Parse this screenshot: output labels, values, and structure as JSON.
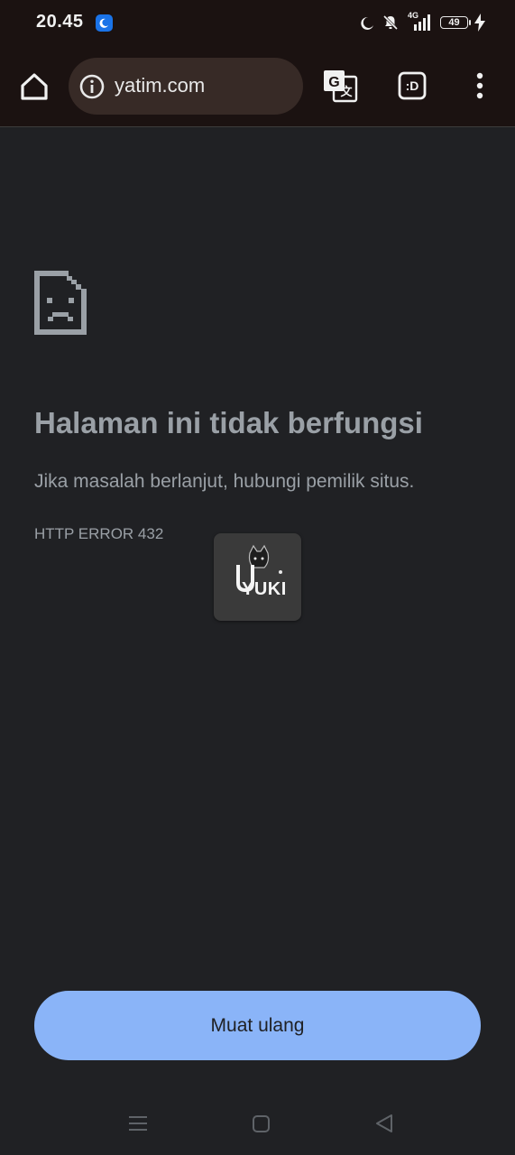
{
  "status_bar": {
    "time": "20.45",
    "network": "4G",
    "battery": "49",
    "icons": [
      "moon-icon",
      "bell-muted-icon",
      "signal-icon",
      "battery-icon",
      "charging-icon"
    ]
  },
  "toolbar": {
    "url": "yatim.com",
    "tabs_label": ":D",
    "icons": [
      "home-icon",
      "info-icon",
      "translate-icon",
      "tabs-icon",
      "more-vert-icon"
    ]
  },
  "error": {
    "title": "Halaman ini tidak berfungsi",
    "description": "Jika masalah berlanjut, hubungi pemilik situs.",
    "code": "HTTP ERROR 432",
    "icon": "sad-page-icon"
  },
  "overlay": {
    "logo_text": "YUKI"
  },
  "actions": {
    "reload_label": "Muat ulang"
  },
  "nav": {
    "icons": [
      "menu-icon",
      "square-icon",
      "back-triangle-icon"
    ]
  },
  "colors": {
    "background": "#202124",
    "toolbar": "#1b1211",
    "omnibox": "#372a26",
    "text": "#9aa0a6",
    "button": "#8ab4f8"
  }
}
